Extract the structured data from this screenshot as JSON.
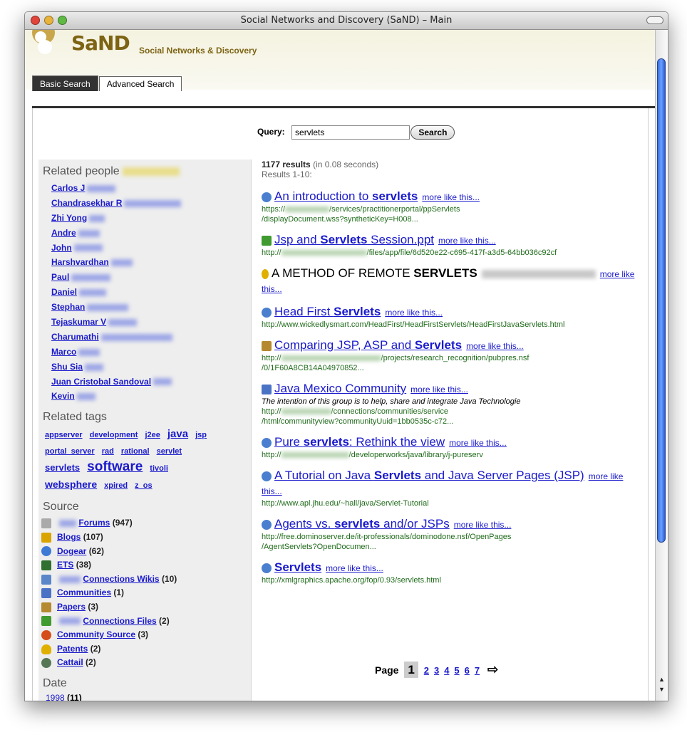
{
  "window": {
    "title": "Social Networks and Discovery (SaND) – Main"
  },
  "brand": {
    "name": "SaND",
    "subtitle": "Social Networks & Discovery"
  },
  "tabs": [
    {
      "label": "Basic Search",
      "active": true
    },
    {
      "label": "Advanced Search",
      "active": false
    }
  ],
  "search": {
    "label": "Query:",
    "value": "servlets",
    "button": "Search"
  },
  "results_meta": {
    "count": "1177 results",
    "time": "(in 0.08 seconds)",
    "range": "Results 1-10:"
  },
  "sidebar": {
    "people_title": "Related people",
    "people": [
      "Carlos J",
      "Chandrasekhar R",
      "Zhi Yong",
      "Andre",
      "John",
      "Harshvardhan",
      "Paul",
      "Daniel",
      "Stephan",
      "Tejaskumar V",
      "Charumathi",
      "Marco",
      "Shu Sia",
      "Juan Cristobal Sandoval",
      "Kevin"
    ],
    "tags_title": "Related tags",
    "tags": [
      {
        "label": "appserver",
        "size": "small"
      },
      {
        "label": "development",
        "size": "small"
      },
      {
        "label": "j2ee",
        "size": "small"
      },
      {
        "label": "java",
        "size": "large"
      },
      {
        "label": "jsp",
        "size": "small"
      },
      {
        "label": "portal_server",
        "size": "small"
      },
      {
        "label": "rad",
        "size": "small"
      },
      {
        "label": "rational",
        "size": "small"
      },
      {
        "label": "servlet",
        "size": "small"
      },
      {
        "label": "servlets",
        "size": "medium"
      },
      {
        "label": "software",
        "size": "xlarge"
      },
      {
        "label": "tivoli",
        "size": "small"
      },
      {
        "label": "websphere",
        "size": "medium"
      },
      {
        "label": "xpired",
        "size": "small"
      },
      {
        "label": "z_os",
        "size": "small"
      }
    ],
    "source_title": "Source",
    "sources": [
      {
        "label": "Forums",
        "count": "(947)",
        "icon": "forum-icon",
        "color": "#999999"
      },
      {
        "label": "Blogs",
        "count": "(107)",
        "icon": "blog-icon",
        "color": "#d9a400"
      },
      {
        "label": "Dogear",
        "count": "(62)",
        "icon": "dogear-icon",
        "color": "#3d7ad6"
      },
      {
        "label": "ETS",
        "count": "(38)",
        "icon": "ets-icon",
        "color": "#2f6f2f"
      },
      {
        "label": "Connections Wikis",
        "count": "(10)",
        "icon": "wiki-icon",
        "color": "#5a86c9"
      },
      {
        "label": "Communities",
        "count": "(1)",
        "icon": "communities-icon",
        "color": "#4a73c5"
      },
      {
        "label": "Papers",
        "count": "(3)",
        "icon": "papers-icon",
        "color": "#b5892f"
      },
      {
        "label": "Connections Files",
        "count": "(2)",
        "icon": "files-icon",
        "color": "#3f9a2f"
      },
      {
        "label": "Community Source",
        "count": "(3)",
        "icon": "community-source-icon",
        "color": "#d44d1a"
      },
      {
        "label": "Patents",
        "count": "(2)",
        "icon": "patent-icon",
        "color": "#e0b000"
      },
      {
        "label": "Cattail",
        "count": "(2)",
        "icon": "cattail-icon",
        "color": "#557755"
      }
    ],
    "date_title": "Date",
    "dates": [
      {
        "label": "1998",
        "count": "(11)"
      }
    ]
  },
  "results": [
    {
      "pre": "An introduction to ",
      "bold": "servlets",
      "post": "",
      "icon": "globe-icon",
      "url1": "https://",
      "url1b": "/services/practitionerportal/ppServlets",
      "url2": "/displayDocument.wss?syntheticKey=H008...",
      "desc": ""
    },
    {
      "pre": "Jsp and ",
      "bold": "Servlets",
      "post": " Session.ppt",
      "icon": "file-icon",
      "url1": "http://",
      "url1b": "/files/app/file/6d520e22-c695-417f-a3d5-64bb036c92cf",
      "url2": "",
      "desc": ""
    },
    {
      "pre": "A METHOD OF REMOTE ",
      "bold": "SERVLETS",
      "post": "",
      "icon": "patent-icon",
      "url1": "",
      "url1b": "",
      "url2": "",
      "desc": "",
      "plain": true
    },
    {
      "pre": "Head First ",
      "bold": "Servlets",
      "post": "",
      "icon": "globe-icon",
      "url1": "http://www.wickedlysmart.com/HeadFirst/HeadFirstServlets/HeadFirstJavaServlets.html",
      "url1b": "",
      "url2": "",
      "desc": ""
    },
    {
      "pre": "Comparing JSP, ASP and ",
      "bold": "Servlets",
      "post": "",
      "icon": "papers-icon",
      "url1": "http://",
      "url1b": "/projects/research_recognition/pubpres.nsf",
      "url2": "/0/1F60A8CB14A04970852...",
      "desc": ""
    },
    {
      "pre": "Java Mexico Community",
      "bold": "",
      "post": "",
      "icon": "communities-icon",
      "url1": "http://",
      "url1b": "/connections/communities/service",
      "url2": "/html/communityview?communityUuid=1bb0535c-c72...",
      "desc": "The intention of this group is to help, share and integrate Java Technologie"
    },
    {
      "pre": "Pure ",
      "bold": "servlets",
      "post": ": Rethink the view",
      "icon": "globe-icon",
      "url1": "http://",
      "url1b": "/developerworks/java/library/j-pureserv",
      "url2": "",
      "desc": ""
    },
    {
      "pre": "A Tutorial on Java ",
      "bold": "Servlets",
      "post": " and Java Server Pages (JSP)",
      "icon": "globe-icon",
      "url1": "http://www.apl.jhu.edu/~hall/java/Servlet-Tutorial",
      "url1b": "",
      "url2": "",
      "desc": ""
    },
    {
      "pre": "Agents vs. ",
      "bold": "servlets",
      "post": " and/or JSPs",
      "icon": "globe-icon",
      "url1": "http://free.dominoserver.de/it-professionals/dominodone.nsf/OpenPages",
      "url1b": "",
      "url2": "/AgentServlets?OpenDocumen...",
      "desc": ""
    },
    {
      "pre": "",
      "bold": "Servlets",
      "post": "",
      "icon": "globe-icon",
      "url1": "http://xmlgraphics.apache.org/fop/0.93/servlets.html",
      "url1b": "",
      "url2": "",
      "desc": ""
    }
  ],
  "more_label": "more like this...",
  "pager": {
    "label": "Page",
    "current": "1",
    "pages": [
      "2",
      "3",
      "4",
      "5",
      "6",
      "7"
    ],
    "next": "⇨"
  }
}
